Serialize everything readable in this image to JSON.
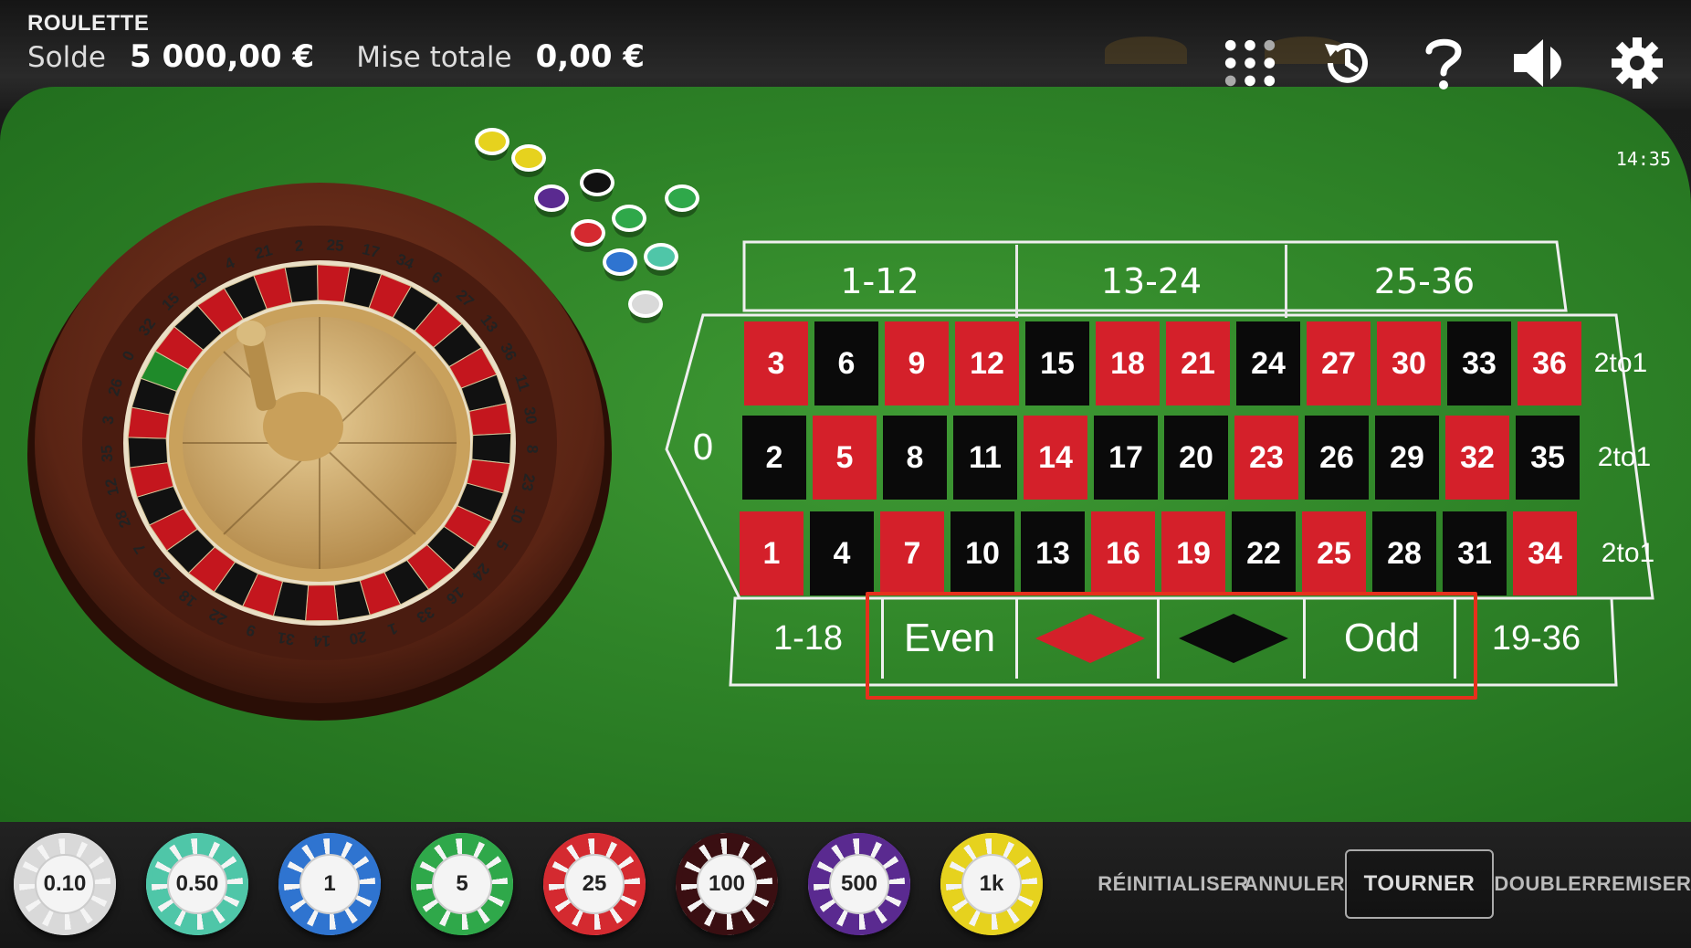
{
  "header": {
    "title": "ROULETTE",
    "balance_label": "Solde",
    "balance_value": "5 000,00 €",
    "total_bet_label": "Mise totale",
    "total_bet_value": "0,00 €",
    "clock": "14:35",
    "icons": [
      "menu-dots-icon",
      "history-icon",
      "help-icon",
      "sound-icon",
      "settings-icon"
    ]
  },
  "board": {
    "zero": "0",
    "dozens": [
      "1-12",
      "13-24",
      "25-36"
    ],
    "column_bets": [
      "2to1",
      "2to1",
      "2to1"
    ],
    "rows": [
      [
        {
          "n": "3",
          "c": "red"
        },
        {
          "n": "6",
          "c": "black"
        },
        {
          "n": "9",
          "c": "red"
        },
        {
          "n": "12",
          "c": "red"
        },
        {
          "n": "15",
          "c": "black"
        },
        {
          "n": "18",
          "c": "red"
        },
        {
          "n": "21",
          "c": "red"
        },
        {
          "n": "24",
          "c": "black"
        },
        {
          "n": "27",
          "c": "red"
        },
        {
          "n": "30",
          "c": "red"
        },
        {
          "n": "33",
          "c": "black"
        },
        {
          "n": "36",
          "c": "red"
        }
      ],
      [
        {
          "n": "2",
          "c": "black"
        },
        {
          "n": "5",
          "c": "red"
        },
        {
          "n": "8",
          "c": "black"
        },
        {
          "n": "11",
          "c": "black"
        },
        {
          "n": "14",
          "c": "red"
        },
        {
          "n": "17",
          "c": "black"
        },
        {
          "n": "20",
          "c": "black"
        },
        {
          "n": "23",
          "c": "red"
        },
        {
          "n": "26",
          "c": "black"
        },
        {
          "n": "29",
          "c": "black"
        },
        {
          "n": "32",
          "c": "red"
        },
        {
          "n": "35",
          "c": "black"
        }
      ],
      [
        {
          "n": "1",
          "c": "red"
        },
        {
          "n": "4",
          "c": "black"
        },
        {
          "n": "7",
          "c": "red"
        },
        {
          "n": "10",
          "c": "black"
        },
        {
          "n": "13",
          "c": "black"
        },
        {
          "n": "16",
          "c": "red"
        },
        {
          "n": "19",
          "c": "red"
        },
        {
          "n": "22",
          "c": "black"
        },
        {
          "n": "25",
          "c": "red"
        },
        {
          "n": "28",
          "c": "black"
        },
        {
          "n": "31",
          "c": "black"
        },
        {
          "n": "34",
          "c": "red"
        }
      ]
    ],
    "outside": {
      "low": "1-18",
      "even": "Even",
      "odd": "Odd",
      "high": "19-36"
    },
    "colors": {
      "red": "#d4202a",
      "black": "#0a0a0a",
      "felt": "#2f8428",
      "highlight": "#e6301c"
    }
  },
  "wheel": {
    "numbers": [
      "0",
      "32",
      "15",
      "19",
      "4",
      "21",
      "2",
      "25",
      "17",
      "34",
      "6",
      "27",
      "13",
      "36",
      "11",
      "30",
      "8",
      "23",
      "10",
      "5",
      "24",
      "16",
      "33",
      "1",
      "20",
      "14",
      "31",
      "9",
      "22",
      "18",
      "29",
      "7",
      "28",
      "12",
      "35",
      "3",
      "26"
    ]
  },
  "chips": [
    {
      "label": "0.10",
      "color": "#d9d9d9"
    },
    {
      "label": "0.50",
      "color": "#4fc6a8"
    },
    {
      "label": "1",
      "color": "#2f74d0"
    },
    {
      "label": "5",
      "color": "#2fa84a"
    },
    {
      "label": "25",
      "color": "#d42a30"
    },
    {
      "label": "100",
      "color": "#3a0f12"
    },
    {
      "label": "500",
      "color": "#5a2a90"
    },
    {
      "label": "1k",
      "color": "#e6d21e"
    }
  ],
  "actions": {
    "reset": "RÉINITIALISER",
    "undo": "ANNULER",
    "spin": "TOURNER",
    "double": "DOUBLER",
    "rebet": "REMISER"
  }
}
